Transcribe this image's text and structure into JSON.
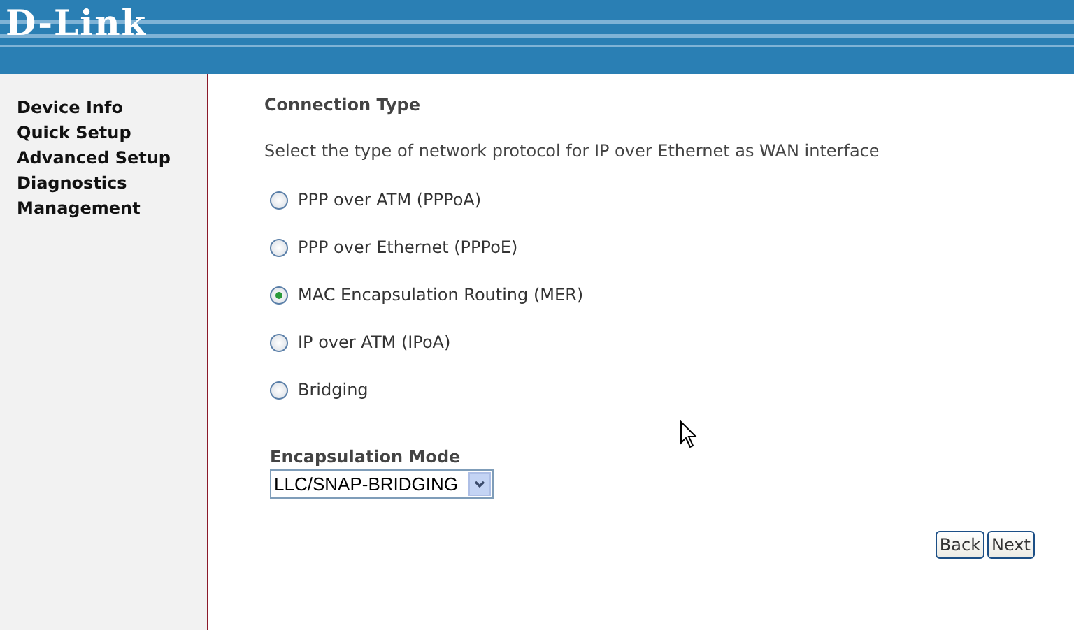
{
  "header": {
    "logo": "D-Link"
  },
  "sidebar": {
    "items": [
      {
        "label": "Device Info"
      },
      {
        "label": "Quick Setup"
      },
      {
        "label": "Advanced Setup"
      },
      {
        "label": "Diagnostics"
      },
      {
        "label": "Management"
      }
    ]
  },
  "content": {
    "title": "Connection Type",
    "description": "Select the type of network protocol for IP over Ethernet as WAN interface",
    "options": [
      {
        "label": "PPP over ATM (PPPoA)",
        "selected": false
      },
      {
        "label": "PPP over Ethernet (PPPoE)",
        "selected": false
      },
      {
        "label": "MAC Encapsulation Routing (MER)",
        "selected": true
      },
      {
        "label": "IP over ATM (IPoA)",
        "selected": false
      },
      {
        "label": "Bridging",
        "selected": false
      }
    ],
    "encapsulation": {
      "label": "Encapsulation Mode",
      "value": "LLC/SNAP-BRIDGING"
    },
    "buttons": [
      "Back",
      "Next"
    ]
  }
}
